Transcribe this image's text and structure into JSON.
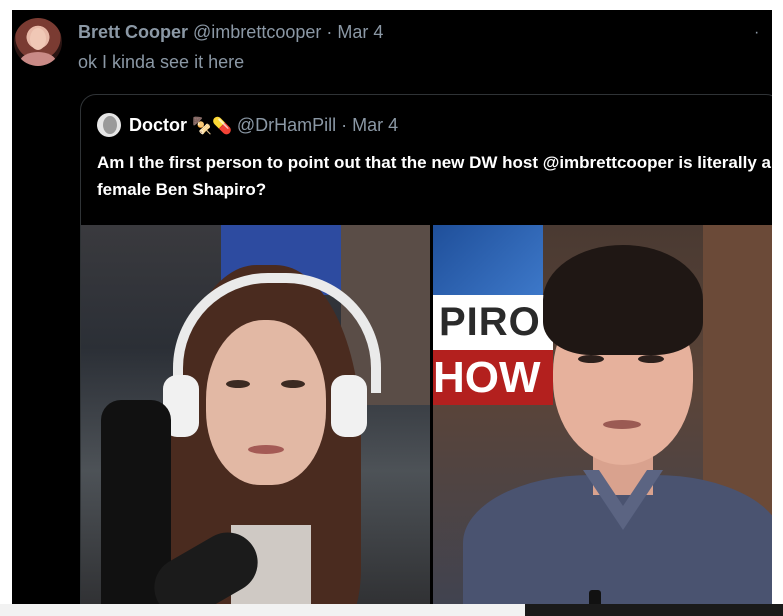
{
  "tweet": {
    "display_name": "Brett Cooper",
    "handle": "@imbrettcooper",
    "separator": " · ",
    "date": "Mar 4",
    "text": "ok I kinda see it here",
    "more_icon": "more-horizontal-icon"
  },
  "quoted_tweet": {
    "display_name": "Doctor",
    "emojis": "🍢💊",
    "handle": "@DrHamPill",
    "separator": " · ",
    "date": "Mar 4",
    "text": "Am I the first person to point out that the new DW host @imbrettcooper is literally a female Ben Shapiro?",
    "media": {
      "right_photo_sign_line1": "PIRO",
      "right_photo_sign_line2": "HOW"
    }
  },
  "colors": {
    "background": "#000000",
    "muted_text": "#8b98a5",
    "primary_text": "#ffffff",
    "border": "#2f3336",
    "sign_red": "#b3201e"
  }
}
